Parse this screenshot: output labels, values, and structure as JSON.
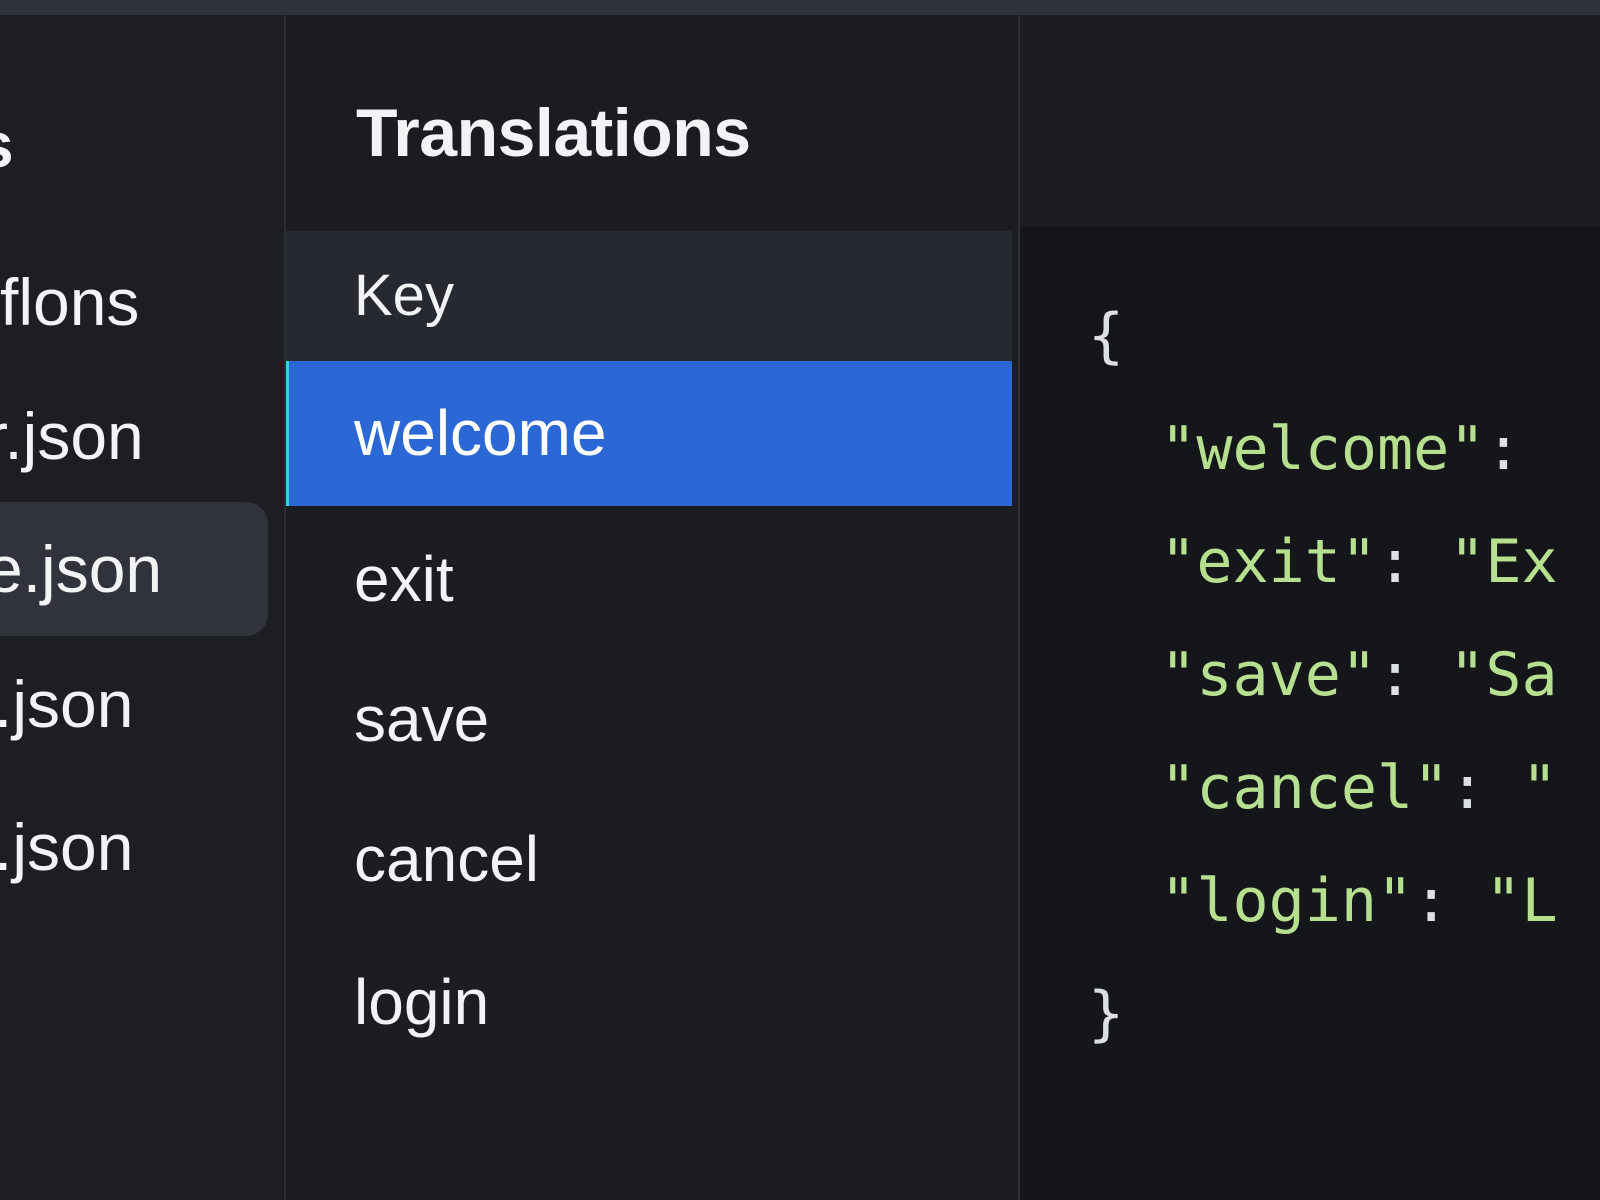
{
  "sidebar": {
    "title": "s",
    "items": [
      {
        "label": "flons",
        "selected": false
      },
      {
        "label": "r.json",
        "selected": false
      },
      {
        "label": "e.json",
        "selected": true
      },
      {
        "label": ".json",
        "selected": false
      },
      {
        "label": ".json",
        "selected": false
      }
    ]
  },
  "keys_panel": {
    "title": "Translations",
    "column_header": "Key",
    "rows": [
      {
        "label": "welcome",
        "selected": true
      },
      {
        "label": "exit",
        "selected": false
      },
      {
        "label": "save",
        "selected": false
      },
      {
        "label": "cancel",
        "selected": false
      },
      {
        "label": "login",
        "selected": false
      }
    ]
  },
  "preview": {
    "open_brace": "{",
    "close_brace": "}",
    "lines": [
      {
        "key": "\"welcome\"",
        "sep": ":",
        "value": ""
      },
      {
        "key": "\"exit\"",
        "sep": ": ",
        "value": "\"Ex"
      },
      {
        "key": "\"save\"",
        "sep": ": ",
        "value": "\"Sa"
      },
      {
        "key": "\"cancel\"",
        "sep": ": ",
        "value": "\""
      },
      {
        "key": "\"login\"",
        "sep": ": ",
        "value": "\"L"
      }
    ]
  },
  "colors": {
    "background": "#1b1d22",
    "selected_row": "#2c68d5",
    "selection_accent": "#35d0e5",
    "json_string": "#b6e08f",
    "text": "#f2f3f5"
  }
}
